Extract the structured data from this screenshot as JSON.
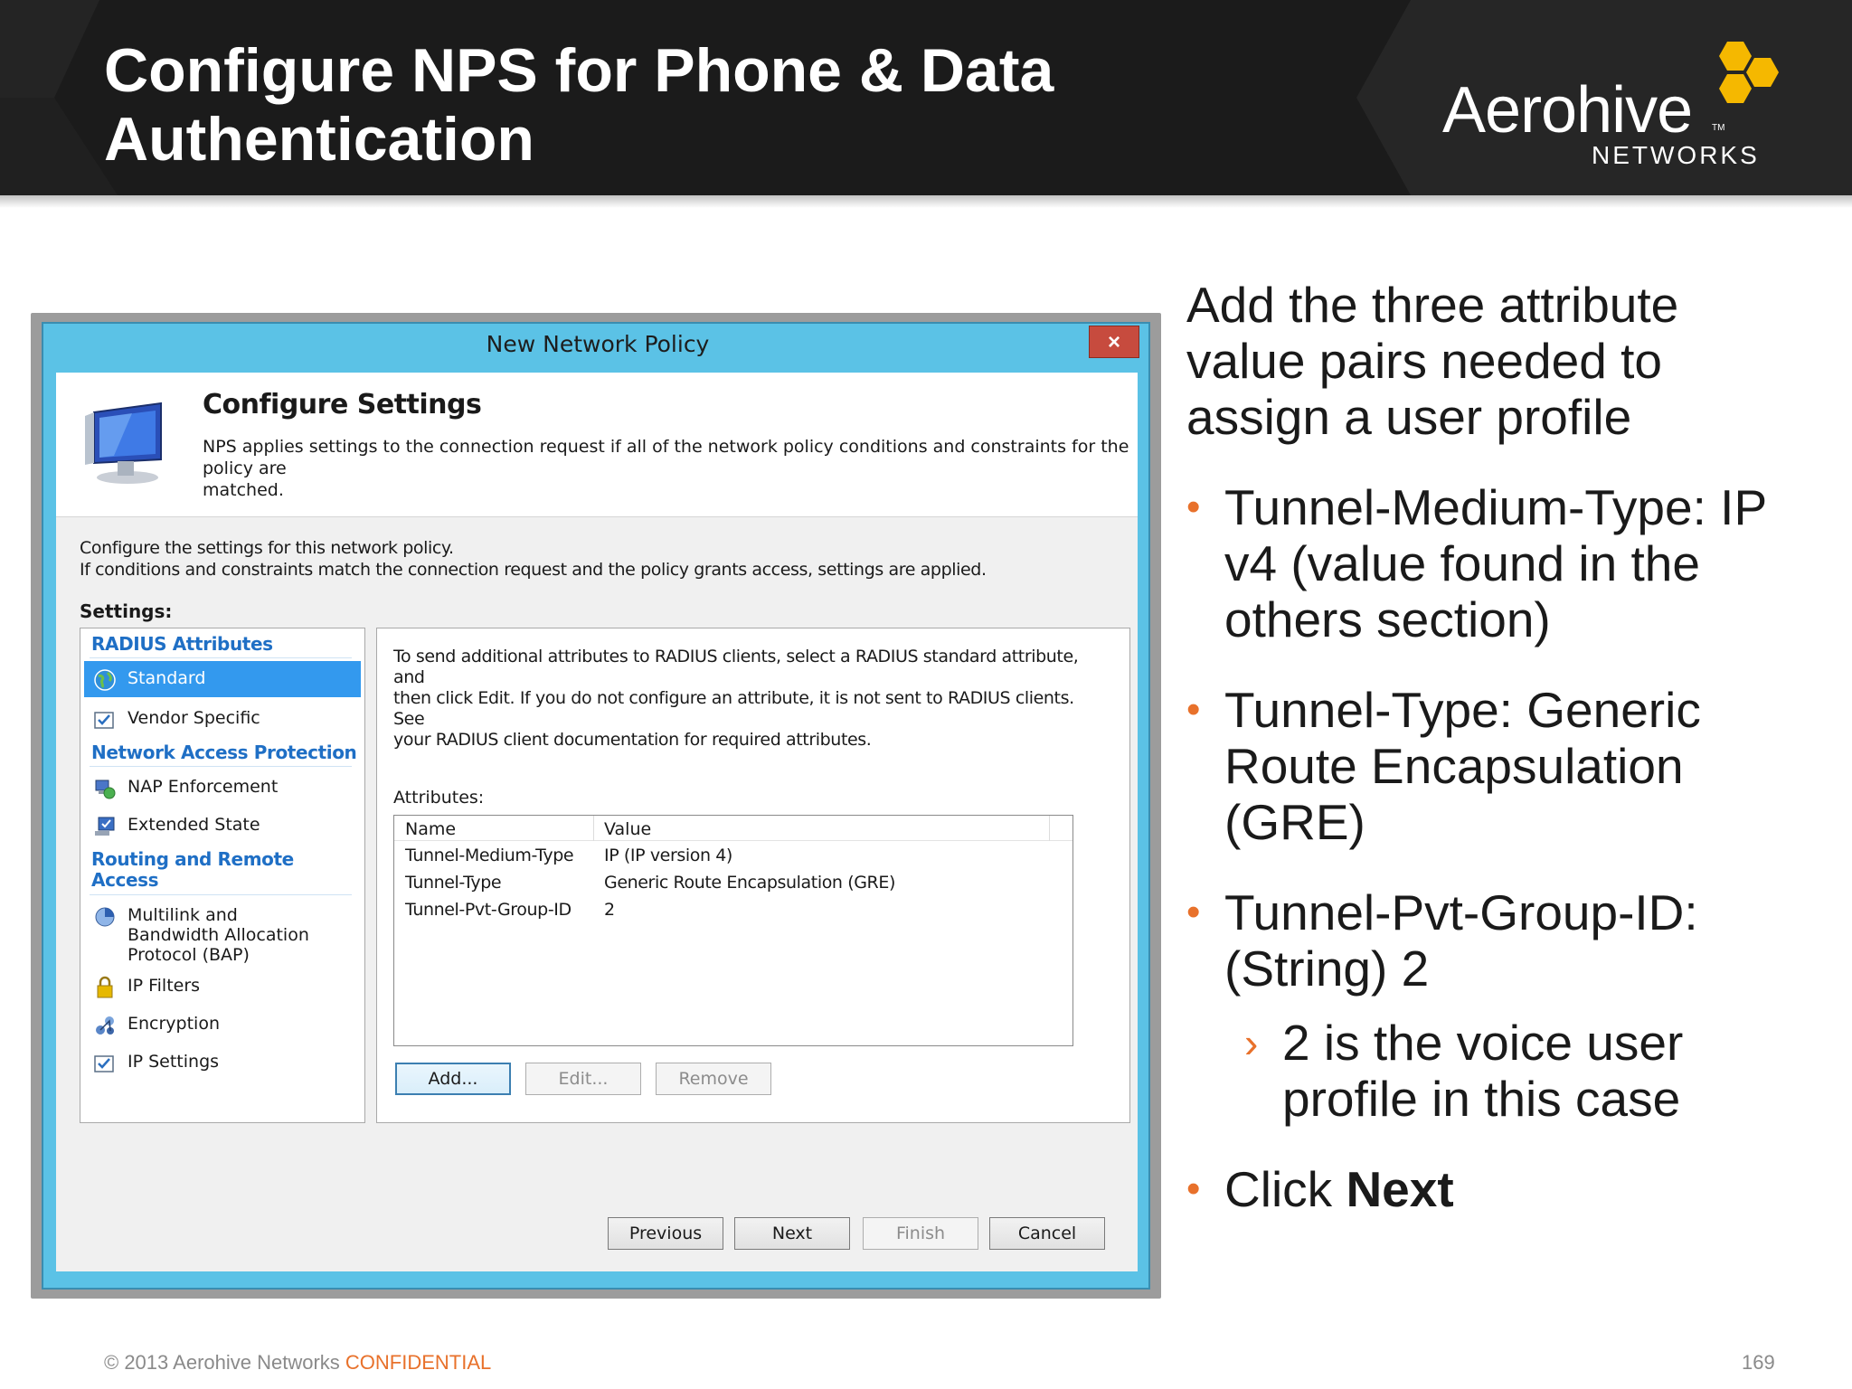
{
  "slide": {
    "title": "Configure NPS for Phone & Data Authentication",
    "logo": {
      "word": "Aerohive",
      "tm": "TM",
      "sub": "NETWORKS"
    },
    "footer": {
      "copyright": "© 2013 Aerohive Networks ",
      "confidential": "CONFIDENTIAL",
      "page_number": "169"
    },
    "colors": {
      "header_bg": "#1b1b1b",
      "accent": "#e8712b",
      "logo_yellow": "#f5b800",
      "dialog_frame": "#5bc2e6"
    }
  },
  "dialog": {
    "title": "New Network Policy",
    "close_label": "×",
    "banner": {
      "heading": "Configure Settings",
      "description": "NPS applies settings to the connection request if all of the network policy conditions and constraints for the policy are\nmatched.",
      "icon": "monitor-icon"
    },
    "intro": "Configure the settings for this network policy.\nIf conditions and constraints match the connection request and the policy grants access, settings are applied.",
    "settings_label": "Settings:",
    "nav": {
      "categories": {
        "radius": "RADIUS Attributes",
        "nap": "Network Access Protection",
        "routing": "Routing and Remote\nAccess"
      },
      "items": {
        "standard": {
          "label": "Standard",
          "icon": "globe-icon",
          "selected": true
        },
        "vendor": {
          "label": "Vendor Specific",
          "icon": "checkbox-icon"
        },
        "nap_enforcement": {
          "label": "NAP Enforcement",
          "icon": "shield-network-icon"
        },
        "extended_state": {
          "label": "Extended State",
          "icon": "computer-check-icon"
        },
        "multilink": {
          "label": "Multilink and\nBandwidth Allocation\nProtocol (BAP)",
          "icon": "pie-icon"
        },
        "ip_filters": {
          "label": "IP Filters",
          "icon": "lock-icon"
        },
        "encryption": {
          "label": "Encryption",
          "icon": "network-key-icon"
        },
        "ip_settings": {
          "label": "IP Settings",
          "icon": "checkbox-icon"
        }
      }
    },
    "panel": {
      "description": "To send additional attributes to RADIUS clients, select a RADIUS standard attribute, and\nthen click Edit. If you do not configure an attribute, it is not sent to RADIUS clients. See\nyour RADIUS client documentation for required attributes.",
      "attributes_label": "Attributes:",
      "columns": {
        "name": "Name",
        "value": "Value"
      },
      "rows": [
        {
          "name": "Tunnel-Medium-Type",
          "value": "IP (IP version 4)"
        },
        {
          "name": "Tunnel-Type",
          "value": "Generic Route Encapsulation (GRE)"
        },
        {
          "name": "Tunnel-Pvt-Group-ID",
          "value": "2"
        }
      ],
      "buttons": {
        "add": "Add...",
        "edit": "Edit...",
        "remove": "Remove"
      }
    },
    "footer_buttons": {
      "previous": "Previous",
      "next": "Next",
      "finish": "Finish",
      "cancel": "Cancel"
    }
  },
  "notes": {
    "intro": "Add the three attribute\nvalue pairs needed to\nassign a user profile",
    "bullet_symbol": "•",
    "sub_symbol": "›",
    "bullets": {
      "medium": "Tunnel-Medium-Type: IP\nv4 (value found in the\nothers section)",
      "type": "Tunnel-Type: Generic\nRoute Encapsulation\n(GRE)",
      "pvt": "Tunnel-Pvt-Group-ID:\n(String) 2",
      "sub": "2 is the voice user\nprofile in this case",
      "click_prefix": "Click ",
      "click_bold": "Next"
    }
  }
}
